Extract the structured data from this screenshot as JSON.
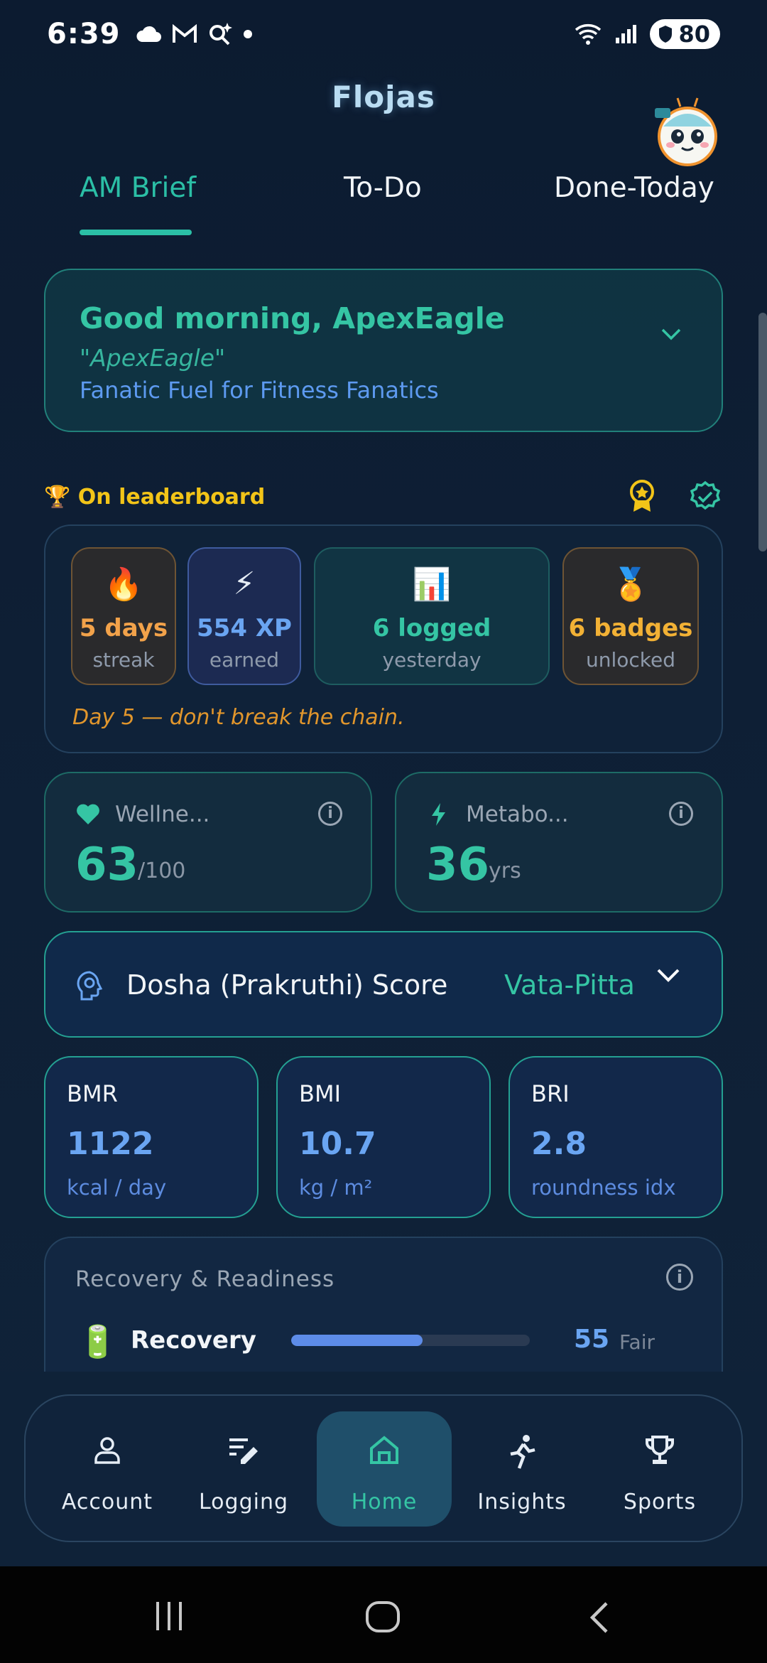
{
  "status_bar": {
    "time": "6:39",
    "battery": "80",
    "wifi_label": "5"
  },
  "app": {
    "title": "Flojas"
  },
  "tabs": [
    {
      "label": "AM Brief",
      "active": true
    },
    {
      "label": "To-Do",
      "active": false
    },
    {
      "label": "Done-Today",
      "active": false
    }
  ],
  "greeting": {
    "hello": "Good morning, ApexEagle",
    "nickname": "\"ApexEagle\"",
    "tagline": "Fanatic Fuel for Fitness Fanatics"
  },
  "leaderboard": {
    "label": "🏆 On leaderboard"
  },
  "stats": [
    {
      "emoji": "🔥",
      "value": "5 days",
      "sub": "streak"
    },
    {
      "emoji": "⚡",
      "value": "554 XP",
      "sub": "earned"
    },
    {
      "emoji": "📊",
      "value": "6 logged",
      "sub": "yesterday"
    },
    {
      "emoji": "🏅",
      "value": "6 badges",
      "sub": "unlocked"
    }
  ],
  "chain_message": "Day 5 — don't break the chain.",
  "wellness": {
    "label": "Wellne...",
    "value": "63",
    "unit": "/100"
  },
  "metabolic": {
    "label": "Metabo...",
    "value": "36",
    "unit": "yrs"
  },
  "dosha": {
    "label": "Dosha (Prakruthi) Score",
    "value": "Vata-Pitta"
  },
  "body_metrics": [
    {
      "label": "BMR",
      "value": "1122",
      "unit": "kcal / day"
    },
    {
      "label": "BMI",
      "value": "10.7",
      "unit": "kg / m²"
    },
    {
      "label": "BRI",
      "value": "2.8",
      "unit": "roundness idx"
    }
  ],
  "recovery": {
    "title": "Recovery & Readiness",
    "label": "Recovery",
    "value": "55",
    "state": "Fair",
    "level_percent": 55
  },
  "bottom_nav": [
    {
      "label": "Account",
      "icon": "person-icon"
    },
    {
      "label": "Logging",
      "icon": "edit-list-icon"
    },
    {
      "label": "Home",
      "icon": "home-icon",
      "active": true
    },
    {
      "label": "Insights",
      "icon": "runner-icon"
    },
    {
      "label": "Sports",
      "icon": "trophy-icon"
    }
  ],
  "colors": {
    "accent": "#35c5a4",
    "blue": "#6aa5f2",
    "gold": "#f2c418",
    "background": "#0c1b30"
  }
}
